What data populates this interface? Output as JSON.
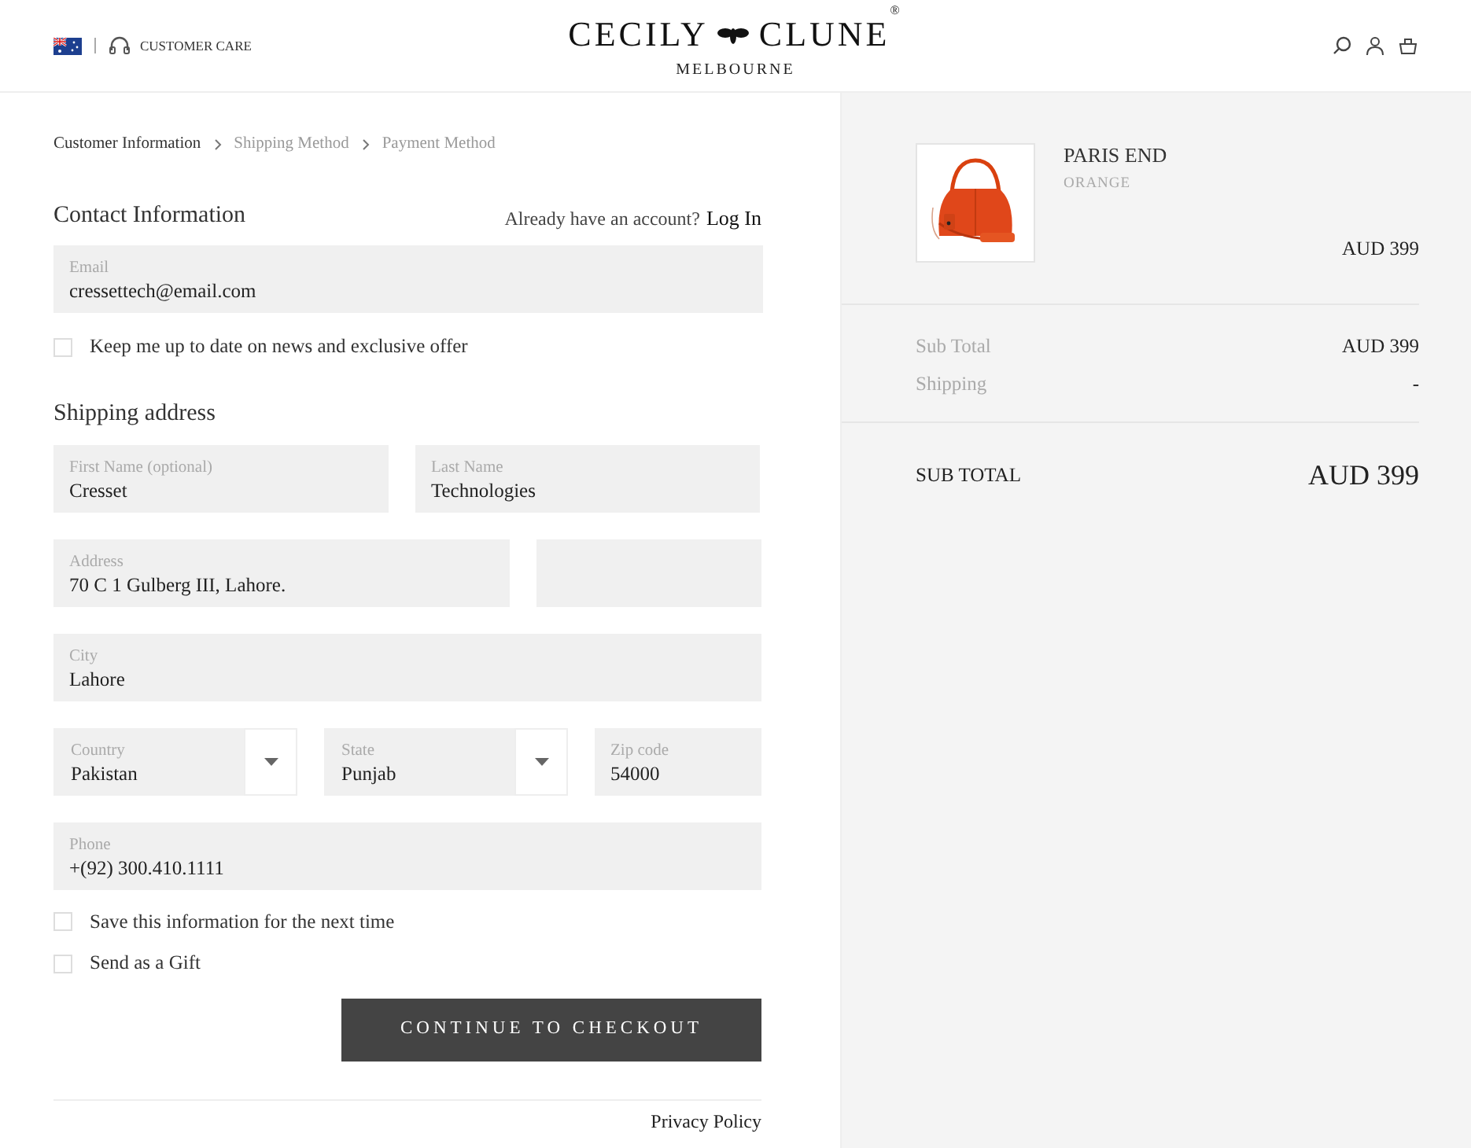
{
  "header": {
    "customer_care": "CUSTOMER CARE",
    "logo_left": "CECILY",
    "logo_right": "CLUNE",
    "logo_mark": "®",
    "logo_sub": "MELBOURNE"
  },
  "breadcrumb": [
    {
      "label": "Customer Information",
      "selected": true
    },
    {
      "label": "Shipping Method",
      "selected": false
    },
    {
      "label": "Payment Method",
      "selected": false
    }
  ],
  "contact": {
    "title": "Contact Information",
    "account_prompt": "Already have an account?",
    "login": "Log In",
    "email": {
      "label": "Email",
      "value": "cressettech@email.com"
    },
    "newsletter": {
      "label": "Keep me up to date on news and exclusive offer",
      "checked": false
    }
  },
  "shipping": {
    "title": "Shipping address",
    "rows": [
      [
        {
          "kind": "text",
          "label": "First Name (optional)",
          "value": "Cresset"
        },
        {
          "kind": "text",
          "label": "Last Name",
          "value": "Technologies"
        }
      ],
      [
        {
          "kind": "text",
          "label": "Address",
          "value": "70 C 1 Gulberg III, Lahore."
        },
        {
          "kind": "text"
        }
      ],
      [
        {
          "kind": "text",
          "label": "City",
          "value": "Lahore"
        }
      ],
      [
        {
          "kind": "select",
          "label": "Country",
          "value": "Pakistan"
        },
        {
          "kind": "select",
          "label": "State",
          "value": "Punjab"
        },
        {
          "kind": "text",
          "label": "Zip code",
          "value": "54000"
        }
      ],
      [
        {
          "kind": "text",
          "label": "Phone",
          "value": "+(92) 300.410.1111"
        }
      ]
    ]
  },
  "options": [
    {
      "label": "Save this information for the next time",
      "checked": false
    },
    {
      "label": "Send as a Gift",
      "checked": false
    }
  ],
  "continue_button": "CONTINUE TO CHECKOUT",
  "footer_link": "Privacy Policy",
  "order": {
    "item": {
      "name": "PARIS END",
      "variant": "ORANGE",
      "price": "AUD 399"
    },
    "lines": [
      {
        "label": "Sub Total",
        "value": "AUD 399"
      },
      {
        "label": "Shipping",
        "value": "-"
      }
    ],
    "total": {
      "label": "SUB TOTAL",
      "value": "AUD 399"
    }
  }
}
